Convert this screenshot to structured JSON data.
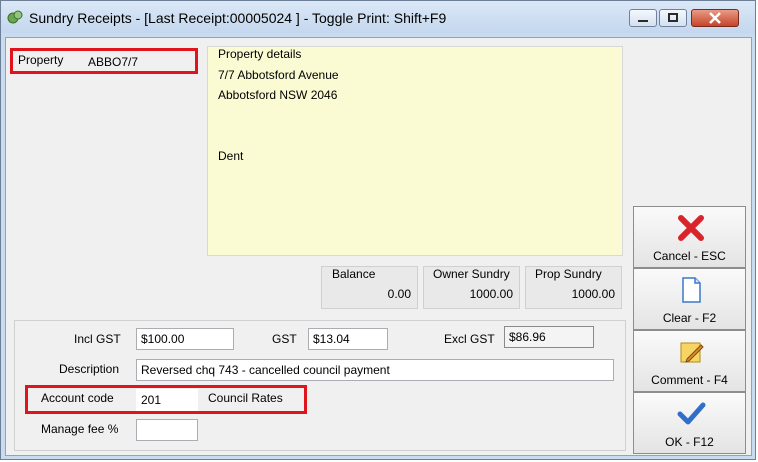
{
  "window": {
    "title": "Sundry Receipts - [Last Receipt:00005024 ] - Toggle Print: Shift+F9",
    "minimize_icon": "minimize-icon",
    "maximize_icon": "maximize-icon",
    "close_icon": "close-icon"
  },
  "property": {
    "label": "Property",
    "value": "ABBO7/7"
  },
  "property_details": {
    "legend": "Property details",
    "line1": "7/7 Abbotsford Avenue",
    "line2": "Abbotsford  NSW  2046",
    "line3": "",
    "line4": "Dent"
  },
  "summary": {
    "balance_label": "Balance",
    "balance_value": "0.00",
    "owner_sundry_label": "Owner Sundry",
    "owner_sundry_value": "1000.00",
    "prop_sundry_label": "Prop Sundry",
    "prop_sundry_value": "1000.00"
  },
  "form": {
    "incl_gst_label": "Incl GST",
    "incl_gst_value": "$100.00",
    "gst_label": "GST",
    "gst_value": "$13.04",
    "excl_gst_label": "Excl GST",
    "excl_gst_value": "$86.96",
    "description_label": "Description",
    "description_value": "Reversed chq 743 - cancelled council payment",
    "account_code_label": "Account code",
    "account_code_value": "201",
    "account_name": "Council Rates",
    "manage_fee_label": "Manage fee %",
    "manage_fee_value": ""
  },
  "buttons": {
    "cancel": "Cancel - ESC",
    "clear": "Clear - F2",
    "comment": "Comment - F4",
    "ok": "OK - F12"
  },
  "colors": {
    "highlight": "#e0141c",
    "details_bg": "#fbfbd3",
    "cancel_icon": "#d8242a",
    "ok_icon": "#2f6fc9",
    "title_bar": "#c4d7ee"
  }
}
